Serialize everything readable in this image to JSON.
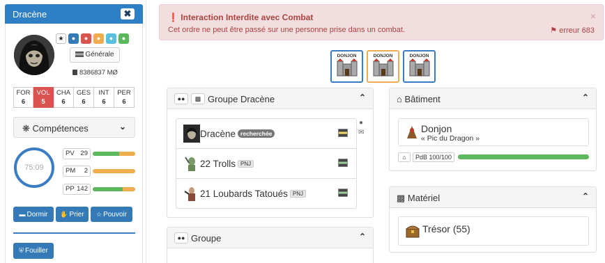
{
  "sidebar": {
    "name": "Dracène",
    "close_label": "✖",
    "star_label": "★",
    "role_icons": [
      "user-blue",
      "user-red",
      "user-orange",
      "user-cyan",
      "user-green"
    ],
    "general_label": "Générale",
    "money": "8386837 MØ",
    "stats": [
      {
        "label": "FOR",
        "value": "6"
      },
      {
        "label": "VOL",
        "value": "5",
        "active": true
      },
      {
        "label": "CHA",
        "value": "6"
      },
      {
        "label": "GES",
        "value": "6"
      },
      {
        "label": "INT",
        "value": "6"
      },
      {
        "label": "PER",
        "value": "6"
      }
    ],
    "competences_label": "Compétences",
    "timer": "75:09",
    "bars": [
      {
        "label": "PV",
        "value": "29",
        "green": 0.62,
        "orange": 0.38
      },
      {
        "label": "PM",
        "value": "2",
        "green": 0.0,
        "orange": 1.0
      },
      {
        "label": "PP",
        "value": "142",
        "green": 0.7,
        "orange": 0.3
      }
    ],
    "buttons": {
      "sleep": "Dormir",
      "pray": "Prier",
      "power": "Pouvoir",
      "search": "Fouiller"
    }
  },
  "alert": {
    "title": "Interaction Interdite avec Combat",
    "message": "Cet ordre ne peut être passé sur une personne prise dans un combat.",
    "close": "×",
    "code": "erreur 683"
  },
  "donjons": [
    "DONJON",
    "DONJON",
    "DONJON"
  ],
  "group_panel": {
    "title": "Groupe Dracène",
    "members": [
      {
        "name": "Dracène",
        "badge": "recherchée"
      },
      {
        "name": "22 Trolls",
        "badge": "PNJ"
      },
      {
        "name": "21 Loubards Tatoués",
        "badge": "PNJ"
      }
    ]
  },
  "group2_panel": {
    "title": "Groupe"
  },
  "building_panel": {
    "title": "Bâtiment",
    "name": "Donjon",
    "subtitle": "« Pic du Dragon »",
    "hp_label": "PdB 100/100",
    "hp_fraction": 1.0
  },
  "materiel_panel": {
    "title": "Matériel",
    "item": "Trésor (55)"
  },
  "colors": {
    "primary": "#337ab7",
    "danger": "#d9534f",
    "warning": "#f0ad4e",
    "success": "#5cb85c"
  }
}
